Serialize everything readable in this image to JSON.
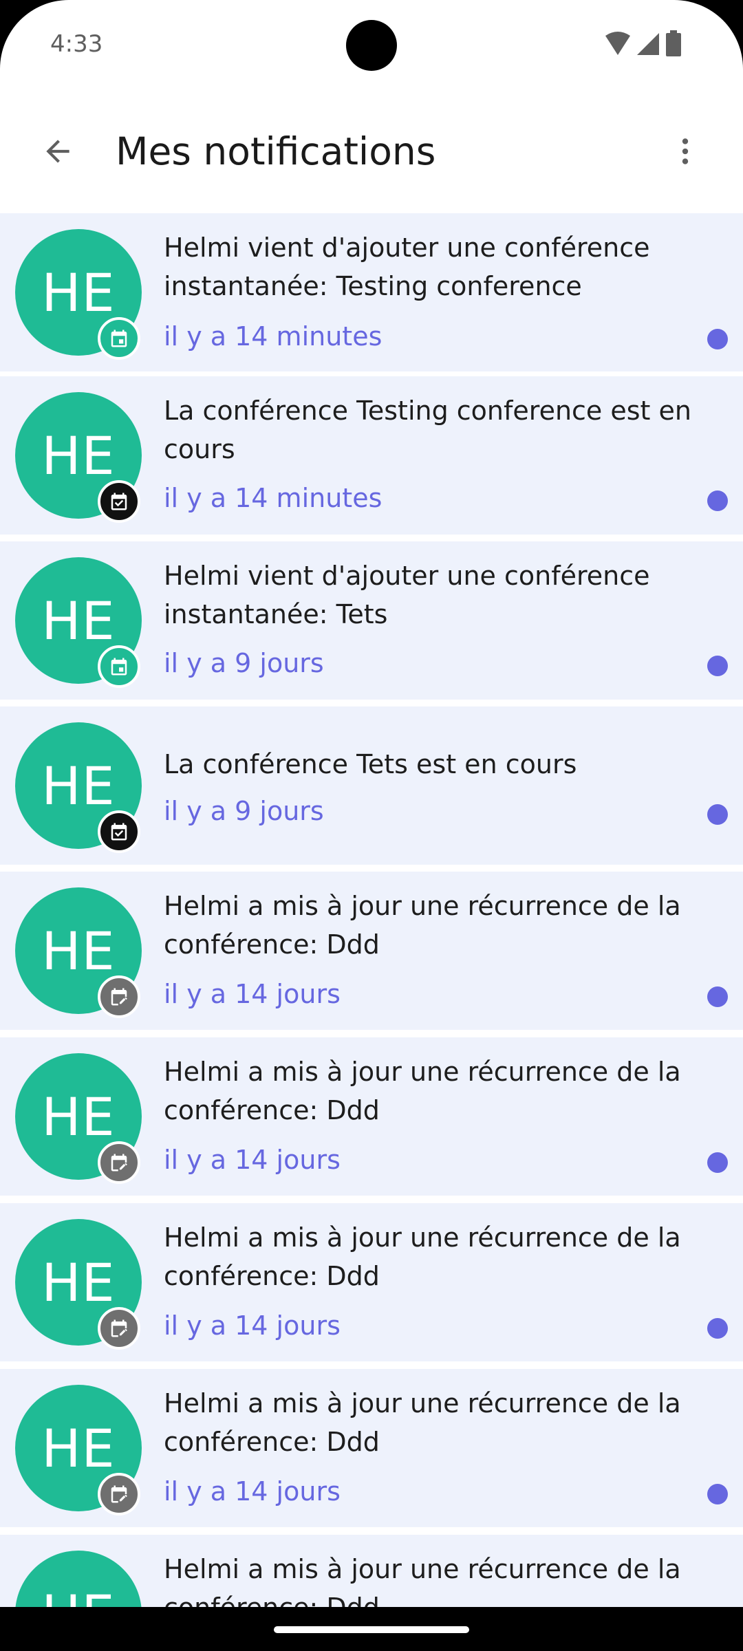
{
  "status_bar": {
    "time": "4:33"
  },
  "app_bar": {
    "title": "Mes notifications",
    "back_icon": "arrow-back-icon",
    "menu_icon": "more-vert-icon"
  },
  "colors": {
    "avatar": "#1fbb95",
    "accent": "#6667e0",
    "row_bg": "#eef2fc"
  },
  "notifications": [
    {
      "initials": "HE",
      "message": "Helmi vient d'ajouter une conférence instantanée: Testing conference",
      "time": "il y a 14 minutes",
      "badge_icon": "calendar-event-icon",
      "unread": true
    },
    {
      "initials": "HE",
      "message": "La conférence Testing conference est en cours",
      "time": "il y a 14 minutes",
      "badge_icon": "calendar-check-icon",
      "unread": true
    },
    {
      "initials": "HE",
      "message": "Helmi vient d'ajouter une conférence instantanée: Tets",
      "time": "il y a 9 jours",
      "badge_icon": "calendar-event-icon",
      "unread": true
    },
    {
      "initials": "HE",
      "message": "La conférence Tets est en cours",
      "time": "il y a 9 jours",
      "badge_icon": "calendar-check-icon",
      "unread": true
    },
    {
      "initials": "HE",
      "message": "Helmi a mis à jour une récurrence de la conférence: Ddd",
      "time": "il y a 14 jours",
      "badge_icon": "calendar-edit-icon",
      "unread": true
    },
    {
      "initials": "HE",
      "message": "Helmi a mis à jour une récurrence de la conférence: Ddd",
      "time": "il y a 14 jours",
      "badge_icon": "calendar-edit-icon",
      "unread": true
    },
    {
      "initials": "HE",
      "message": "Helmi a mis à jour une récurrence de la conférence: Ddd",
      "time": "il y a 14 jours",
      "badge_icon": "calendar-edit-icon",
      "unread": true
    },
    {
      "initials": "HE",
      "message": "Helmi a mis à jour une récurrence de la conférence: Ddd",
      "time": "il y a 14 jours",
      "badge_icon": "calendar-edit-icon",
      "unread": true
    },
    {
      "initials": "HE",
      "message": "Helmi a mis à jour une récurrence de la conférence: Ddd",
      "time": "",
      "badge_icon": "calendar-edit-icon",
      "unread": true
    }
  ]
}
